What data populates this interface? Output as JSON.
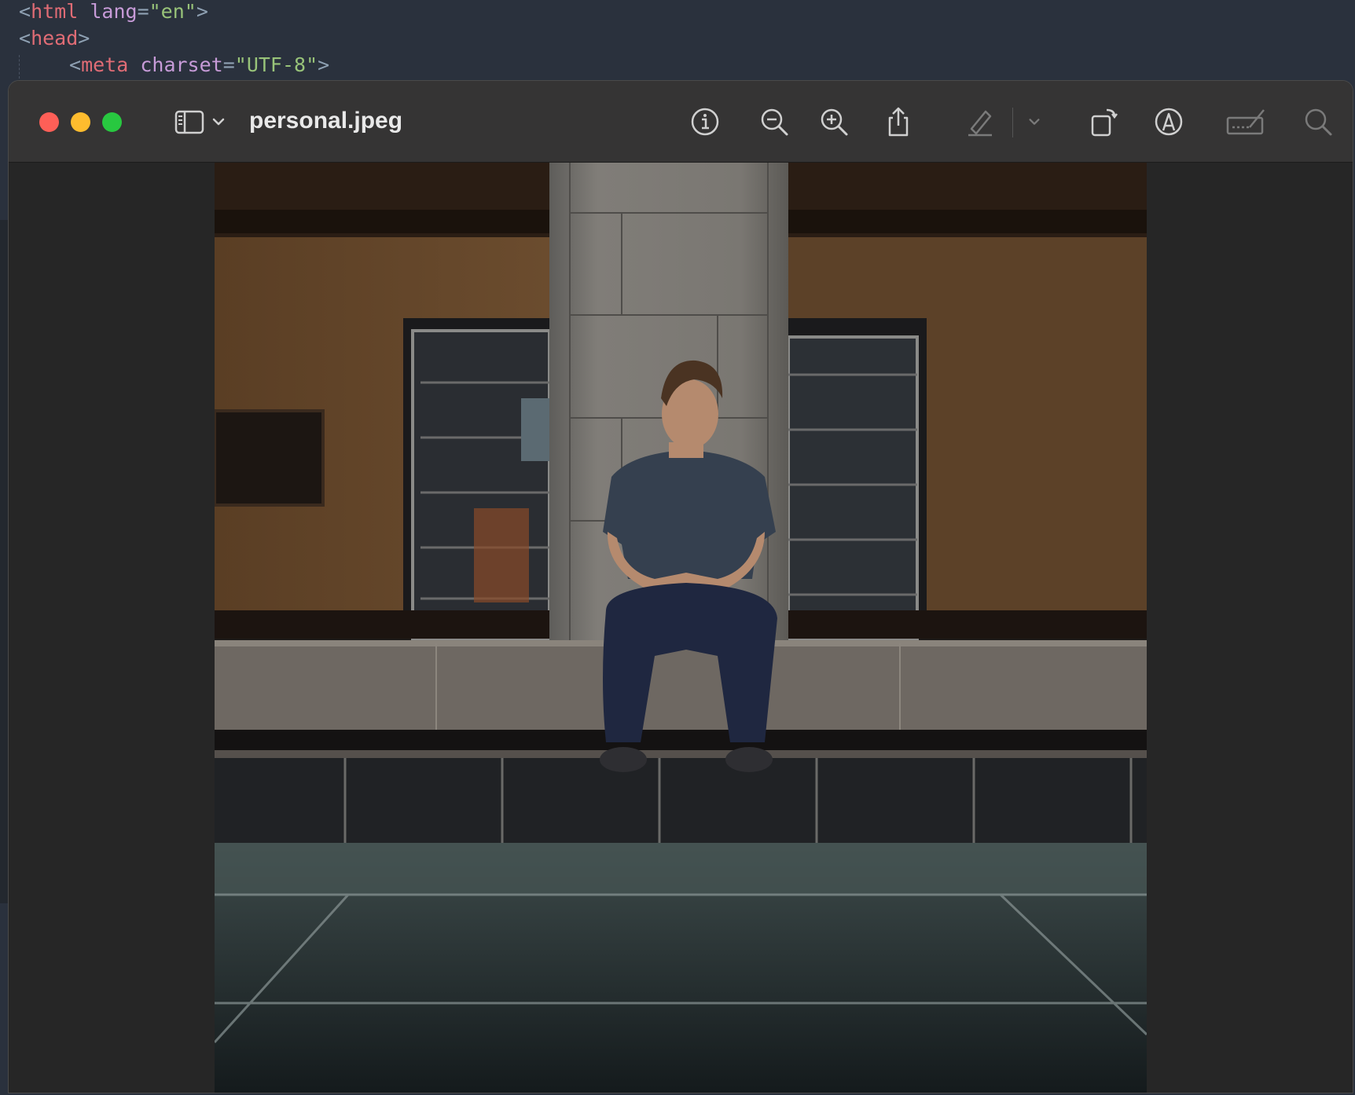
{
  "editor": {
    "lines": [
      {
        "open": "<",
        "tag": "html",
        "attr": "lang",
        "eq": "=",
        "value": "\"en\"",
        "close": ">"
      },
      {
        "open": "<",
        "tag": "head",
        "close": ">"
      },
      {
        "open": "<",
        "tag": "meta",
        "attr": "charset",
        "eq": "=",
        "value": "\"UTF-8\"",
        "close": ">"
      }
    ]
  },
  "window": {
    "title": "personal.jpeg",
    "toolbar": {
      "icons": [
        "sidebar-toggle-icon",
        "chevron-down-icon",
        "info-icon",
        "zoom-out-icon",
        "zoom-in-icon",
        "share-icon",
        "highlight-pen-icon",
        "chevron-down-icon",
        "rotate-icon",
        "markup-icon",
        "signature-icon",
        "search-icon"
      ]
    },
    "image": {
      "description_icon": "photo",
      "subject": "person-seated-on-stone-ledge"
    }
  },
  "colors": {
    "close": "#fe5f57",
    "minimize": "#febc2e",
    "zoom": "#28c840",
    "titlebar": "#353434",
    "editor_bg": "#2a313d"
  }
}
